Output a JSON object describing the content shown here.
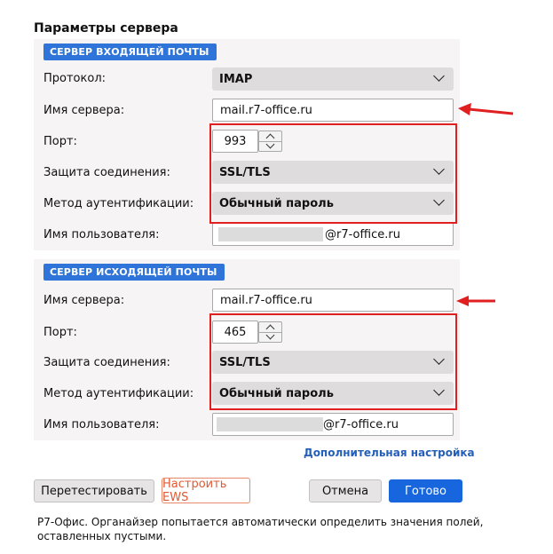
{
  "dialog": {
    "title": "Параметры сервера"
  },
  "incoming": {
    "section_label": "СЕРВЕР ВХОДЯЩЕЙ ПОЧТЫ",
    "protocol_label": "Протокол:",
    "protocol_value": "IMAP",
    "server_label": "Имя сервера:",
    "server_value": "mail.r7-office.ru",
    "port_label": "Порт:",
    "port_value": "993",
    "security_label": "Защита соединения:",
    "security_value": "SSL/TLS",
    "auth_label": "Метод аутентификации:",
    "auth_value": "Обычный пароль",
    "user_label": "Имя пользователя:",
    "user_suffix": "@r7-office.ru"
  },
  "outgoing": {
    "section_label": "СЕРВЕР ИСХОДЯЩЕЙ ПОЧТЫ",
    "server_label": "Имя сервера:",
    "server_value": "mail.r7-office.ru",
    "port_label": "Порт:",
    "port_value": "465",
    "security_label": "Защита соединения:",
    "security_value": "SSL/TLS",
    "auth_label": "Метод аутентификации:",
    "auth_value": "Обычный пароль",
    "user_label": "Имя пользователя:",
    "user_suffix": "@r7-office.ru"
  },
  "advanced_link": "Дополнительная настройка",
  "buttons": {
    "retest": "Перетестировать",
    "ews": "Настроить EWS",
    "cancel": "Отмена",
    "done": "Готово"
  },
  "note": "Р7-Офис. Органайзер попытается автоматически определить значения полей, оставленных пустыми.",
  "colors": {
    "accent": "#1766de",
    "badge": "#2f74d8",
    "highlight": "#e02020",
    "ews": "#e05a33"
  },
  "icons": {
    "dropdown": "chevron-down-icon",
    "spinner": "spin-arrows-icon",
    "annotation": "red-arrow-icon"
  }
}
